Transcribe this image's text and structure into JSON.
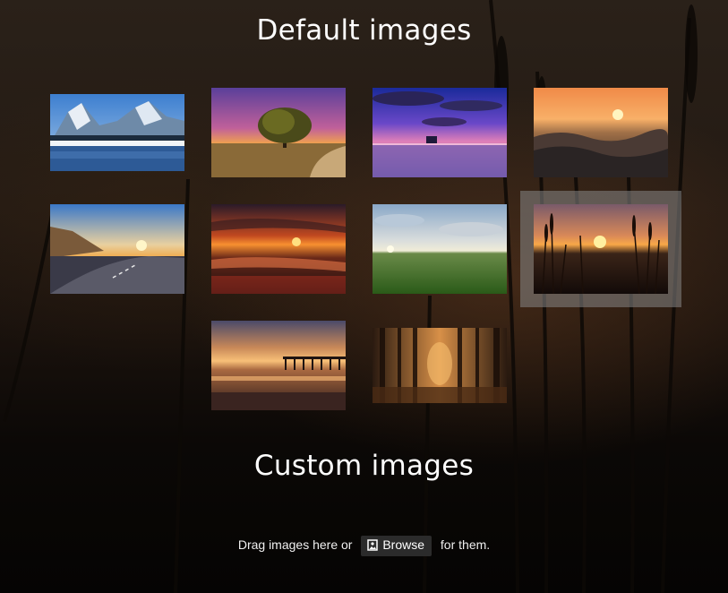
{
  "sections": {
    "default_title": "Default images",
    "custom_title": "Custom images"
  },
  "thumbnails": [
    {
      "name": "mountain-lake-snow",
      "selected": false
    },
    {
      "name": "tree-purple-sunset",
      "selected": false
    },
    {
      "name": "purple-clouds-lake",
      "selected": false
    },
    {
      "name": "ocean-waves-sunset",
      "selected": false
    },
    {
      "name": "mountain-road-sunset",
      "selected": false
    },
    {
      "name": "beach-red-sunset",
      "selected": false
    },
    {
      "name": "green-field-sky",
      "selected": false
    },
    {
      "name": "grass-silhouette-sunset",
      "selected": true
    },
    {
      "name": "pier-sunset",
      "selected": false
    },
    {
      "name": "autumn-forest",
      "selected": false
    }
  ],
  "custom": {
    "drag_text": "Drag images here or",
    "browse_label": "Browse",
    "browse_icon": "image-icon",
    "suffix_text": "for them."
  }
}
